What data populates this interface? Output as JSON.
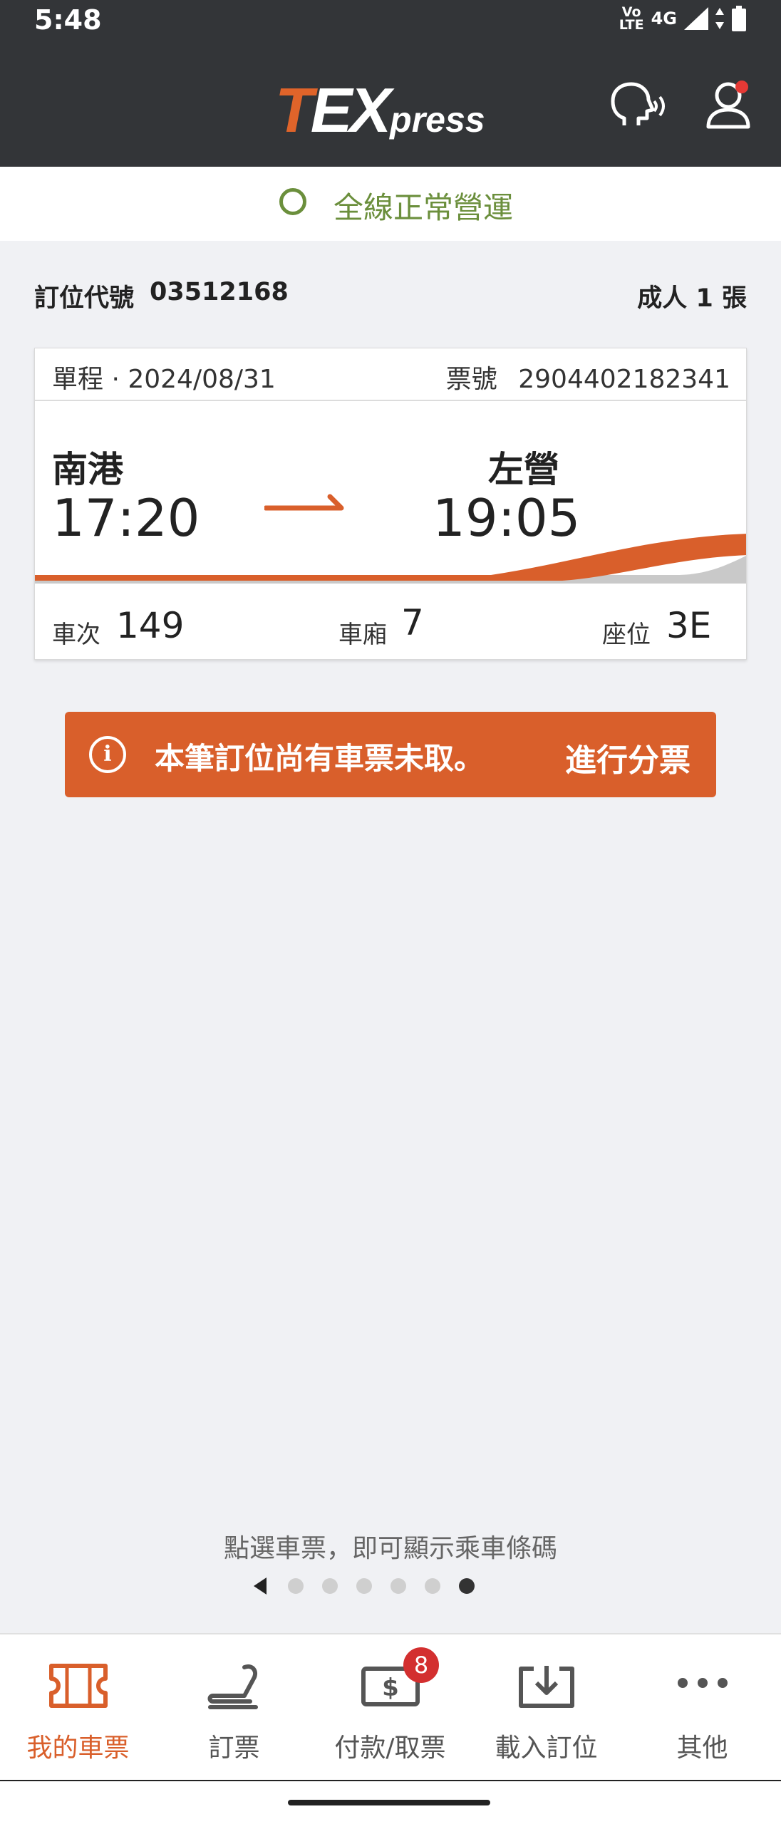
{
  "status_bar": {
    "time": "5:48",
    "volte": "Vo LTE",
    "network": "4G"
  },
  "app_bar": {
    "logo_t": "T",
    "logo_ex": "EX",
    "logo_press": "press",
    "icons": [
      "voice-assist-icon",
      "user-profile-icon"
    ]
  },
  "service_status": {
    "text": "全線正常營運",
    "color": "#6b8f3c"
  },
  "booking": {
    "pnr_label": "訂位代號",
    "pnr_value": "03512168",
    "passengers": "成人 1 張"
  },
  "ticket": {
    "trip_info": "單程 · 2024/08/31",
    "ticket_no_label": "票號",
    "ticket_no": "2904402182341",
    "from_station": "南港",
    "from_time": "17:20",
    "to_station": "左營",
    "to_time": "19:05",
    "train_label": "車次",
    "train_no": "149",
    "car_label": "車廂",
    "car_no": "7",
    "seat_label": "座位",
    "seat_no": "3E"
  },
  "warning": {
    "message": "本筆訂位尚有車票未取。",
    "action": "進行分票",
    "color": "#d95f2b"
  },
  "hint": "點選車票，即可顯示乘車條碼",
  "pager": {
    "total": 6,
    "current": 6
  },
  "nav": {
    "items": [
      {
        "label": "我的車票",
        "icon": "ticket-icon",
        "active": true
      },
      {
        "label": "訂票",
        "icon": "seat-icon",
        "active": false
      },
      {
        "label": "付款/取票",
        "icon": "payment-icon",
        "active": false,
        "badge": "8"
      },
      {
        "label": "載入訂位",
        "icon": "download-icon",
        "active": false
      },
      {
        "label": "其他",
        "icon": "more-icon",
        "active": false
      }
    ]
  },
  "colors": {
    "accent": "#d95f2b",
    "dark": "#333538"
  }
}
